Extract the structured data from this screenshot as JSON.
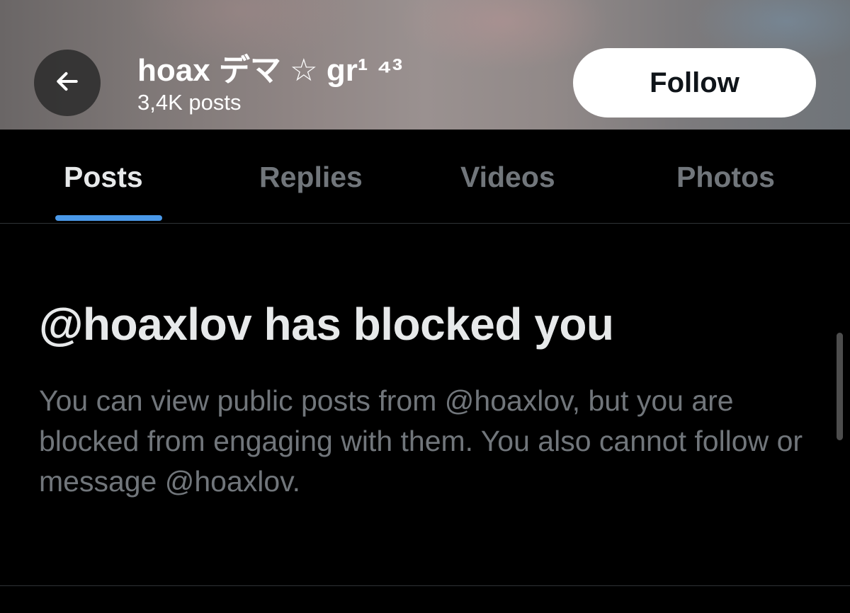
{
  "header": {
    "profile_name": "hoax デマ ☆ gr¹ ⁴³",
    "post_count": "3,4K posts",
    "follow_label": "Follow"
  },
  "tabs": [
    {
      "label": "Posts",
      "active": true
    },
    {
      "label": "Replies",
      "active": false
    },
    {
      "label": "Videos",
      "active": false
    },
    {
      "label": "Photos",
      "active": false
    }
  ],
  "blocked": {
    "title": "@hoaxlov has blocked you",
    "description": "You can view public posts from @hoaxlov, but you are blocked from engaging with them. You also cannot follow or message @hoaxlov."
  },
  "icons": {
    "back": "arrow-left-icon"
  },
  "colors": {
    "background": "#000000",
    "primary_text": "#e7e9ea",
    "secondary_text": "#71767b",
    "accent": "#4a99e9",
    "follow_button_bg": "#ffffff"
  }
}
